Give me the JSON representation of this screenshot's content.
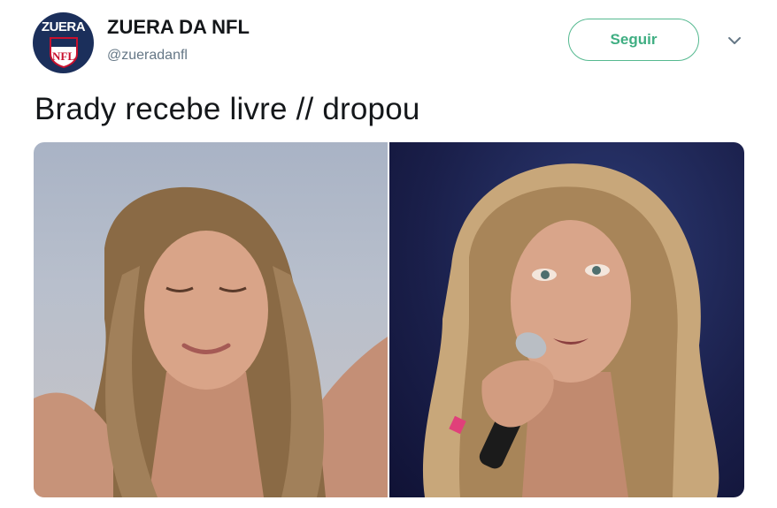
{
  "account": {
    "name": "ZUERA DA NFL",
    "handle": "@zueradanfl",
    "avatar_logo_text": "ZUERA",
    "avatar_shield_text": "NFL"
  },
  "follow_button": {
    "label": "Seguir"
  },
  "menu": {
    "icon": "chevron-down-icon"
  },
  "tweet": {
    "text": "Brady recebe livre // dropou"
  },
  "colors": {
    "follow_accent": "#3fae82",
    "text_primary": "#14171a",
    "text_secondary": "#657786",
    "avatar_bg": "#1b2f5b"
  }
}
